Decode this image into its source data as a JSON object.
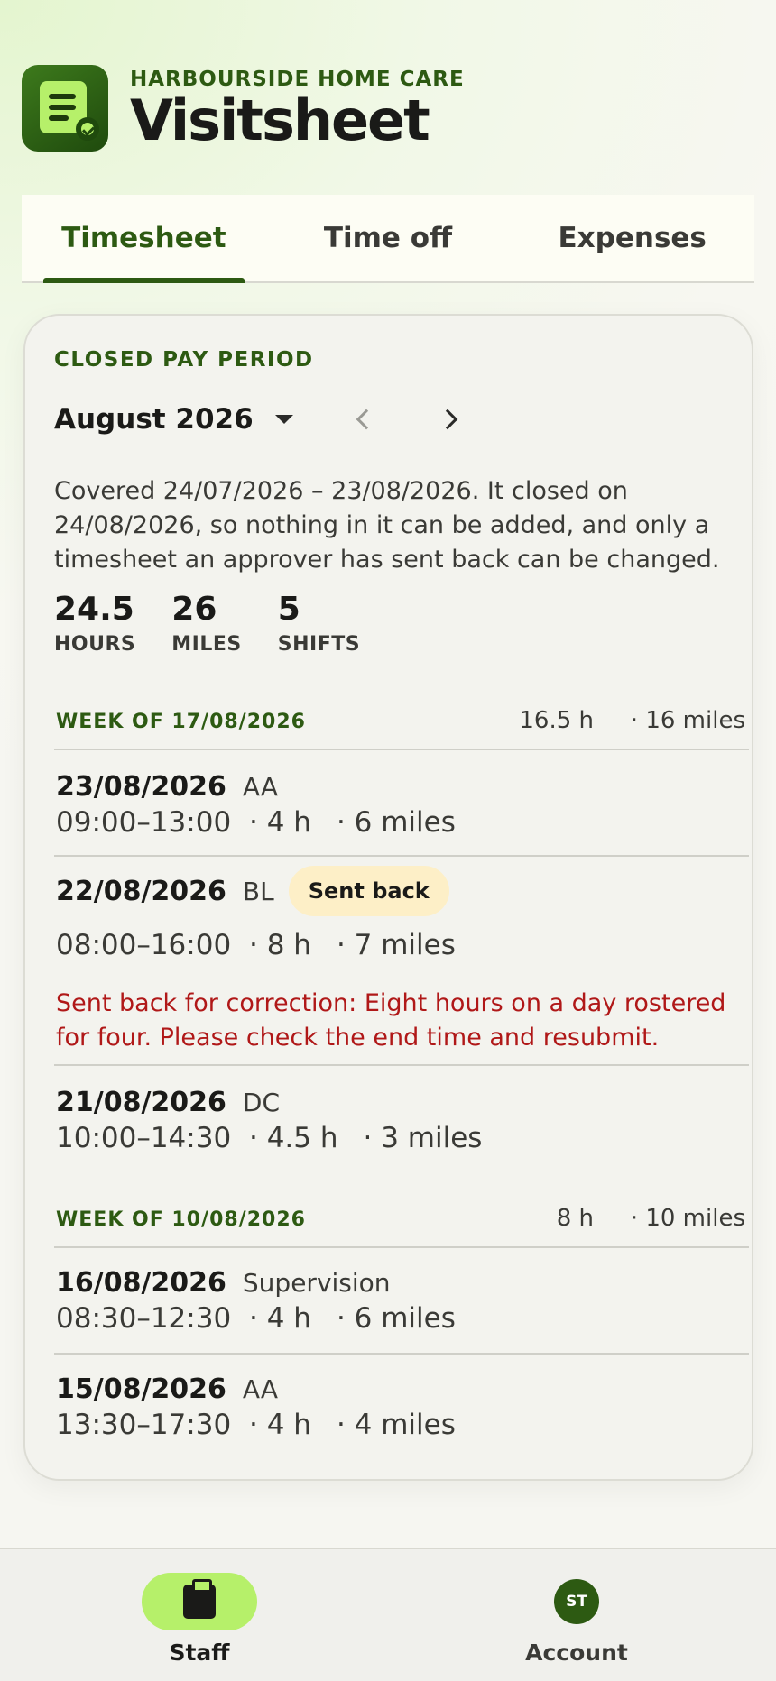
{
  "header": {
    "org": "HARBOURSIDE HOME CARE",
    "title": "Visitsheet",
    "logo_icon": "timesheet-check-icon"
  },
  "tabs": [
    {
      "label": "Timesheet",
      "active": true
    },
    {
      "label": "Time off",
      "active": false
    },
    {
      "label": "Expenses",
      "active": false
    }
  ],
  "period": {
    "status_label": "CLOSED PAY PERIOD",
    "name": "August 2026",
    "note": "Covered 24/07/2026 – 23/08/2026. It closed on 24/08/2026, so nothing in it can be added, and only a timesheet an approver has sent back can be changed."
  },
  "stats": [
    {
      "value": "24.5",
      "label": "HOURS"
    },
    {
      "value": "26",
      "label": "MILES"
    },
    {
      "value": "5",
      "label": "SHIFTS"
    }
  ],
  "weeks": [
    {
      "title": "WEEK OF 17/08/2026",
      "hours": "16.5 h",
      "miles": "· 16 miles",
      "entries": [
        {
          "date": "23/08/2026",
          "code": "AA",
          "time": "09:00–13:00",
          "hours": "· 4 h",
          "miles": "· 6 miles"
        },
        {
          "date": "22/08/2026",
          "code": "BL",
          "badge": "Sent back",
          "time": "08:00–16:00",
          "hours": "· 8 h",
          "miles": "· 7 miles",
          "correction": "Sent back for correction: Eight hours on a day rostered for four. Please check the end time and resubmit."
        },
        {
          "date": "21/08/2026",
          "code": "DC",
          "time": "10:00–14:30",
          "hours": "· 4.5 h",
          "miles": "· 3 miles"
        }
      ]
    },
    {
      "title": "WEEK OF 10/08/2026",
      "hours": "8 h",
      "miles": "· 10 miles",
      "entries": [
        {
          "date": "16/08/2026",
          "code": "Supervision",
          "time": "08:30–12:30",
          "hours": "· 4 h",
          "miles": "· 6 miles"
        },
        {
          "date": "15/08/2026",
          "code": "AA",
          "time": "13:30–17:30",
          "hours": "· 4 h",
          "miles": "· 4 miles"
        }
      ]
    }
  ],
  "bottom_nav": {
    "staff_label": "Staff",
    "account_label": "Account",
    "avatar_initials": "ST"
  },
  "colors": {
    "accent": "#2d5a12",
    "accent_light": "#b6f06a",
    "badge_bg": "#fdefc7",
    "error": "#b01818"
  }
}
